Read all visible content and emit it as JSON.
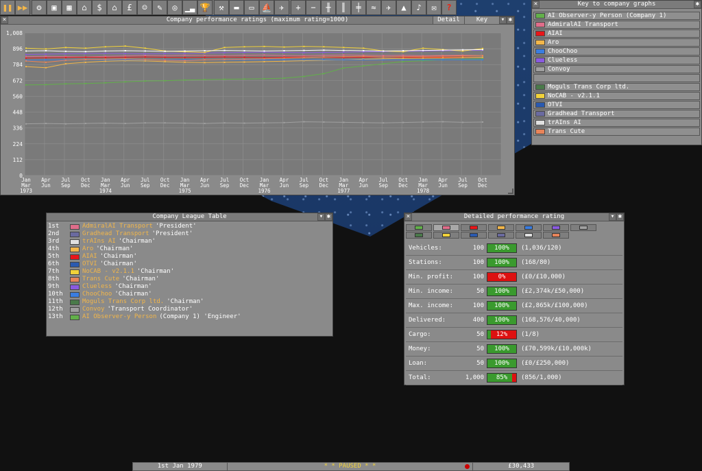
{
  "toolbar": {
    "icons": [
      "pause-icon",
      "fast-forward-icon",
      "settings-icon",
      "save-icon",
      "map-icon",
      "town-directory-icon",
      "subsidies-icon",
      "stations-icon",
      "finances-icon",
      "company-icon",
      "story-icon",
      "goals-icon",
      "graphs-icon",
      "league-icon",
      "industries-icon",
      "trains-icon",
      "road-vehicles-icon",
      "ships-icon",
      "aircraft-icon",
      "zoom-in-icon",
      "zoom-out-icon",
      "build-rail-icon",
      "build-road-icon",
      "build-tramway-icon",
      "build-water-icon",
      "build-air-icon",
      "landscaping-icon",
      "music-icon",
      "messages-icon",
      "help-icon"
    ]
  },
  "graph_window": {
    "title": "Company performance ratings (maximum rating=1000)",
    "detail_button": "Detail",
    "key_button": "Key"
  },
  "chart_data": {
    "type": "line",
    "title": "Company performance ratings (maximum rating=1000)",
    "ylim": [
      0,
      1008
    ],
    "yticks": [
      "0",
      "112",
      "224",
      "336",
      "448",
      "560",
      "672",
      "784",
      "896",
      "1,008"
    ],
    "x_months": [
      "Jan",
      "Apr",
      "Jul",
      "Oct",
      "Jan",
      "Apr",
      "Jul",
      "Oct",
      "Jan",
      "Apr",
      "Jul",
      "Oct",
      "Jan",
      "Apr",
      "Jul",
      "Oct",
      "Jan",
      "Apr",
      "Jul",
      "Oct",
      "Jan",
      "Apr",
      "Jul",
      "Oct"
    ],
    "x_sub": [
      "Mar",
      "Jun",
      "Sep",
      "Dec",
      "Mar",
      "Jun",
      "Sep",
      "Dec",
      "Mar",
      "Jun",
      "Sep",
      "Dec",
      "Mar",
      "Jun",
      "Sep",
      "Dec",
      "Mar",
      "Jun",
      "Sep",
      "Dec",
      "Mar",
      "Jun",
      "Sep",
      "Dec"
    ],
    "x_years": {
      "0": "1973",
      "4": "1974",
      "8": "1975",
      "12": "1976",
      "16": "1977",
      "20": "1978"
    },
    "series": [
      {
        "color": "#62b04a",
        "values": [
          640,
          642,
          648,
          650,
          655,
          662,
          668,
          670,
          675,
          678,
          680,
          682,
          684,
          688,
          700,
          720,
          760,
          775,
          790,
          805,
          812,
          818,
          822,
          825
        ]
      },
      {
        "color": "#e06d8a",
        "values": [
          840,
          842,
          840,
          838,
          842,
          845,
          848,
          846,
          850,
          848,
          846,
          850,
          852,
          848,
          846,
          850,
          852,
          850,
          848,
          850,
          846,
          848,
          850,
          848
        ]
      },
      {
        "color": "#e8161a",
        "values": [
          830,
          832,
          834,
          836,
          834,
          836,
          838,
          836,
          834,
          836,
          838,
          836,
          834,
          836,
          838,
          836,
          834,
          836,
          838,
          836,
          834,
          836,
          838,
          836
        ]
      },
      {
        "color": "#f2b64a",
        "values": [
          770,
          762,
          790,
          800,
          808,
          812,
          810,
          805,
          800,
          798,
          800,
          802,
          805,
          808,
          812,
          815,
          818,
          822,
          825,
          828,
          830,
          832,
          835,
          836
        ]
      },
      {
        "color": "#3a7de0",
        "values": [
          815,
          818,
          818,
          820,
          818,
          818,
          818,
          818,
          818,
          818,
          818,
          818,
          818,
          818,
          818,
          818,
          818,
          818,
          818,
          818,
          818,
          818,
          818,
          818
        ]
      },
      {
        "color": "#8a5ae0",
        "values": [
          855,
          858,
          860,
          862,
          864,
          862,
          860,
          862,
          864,
          866,
          868,
          870,
          872,
          870,
          868,
          870,
          872,
          874,
          876,
          878,
          880,
          882,
          884,
          886
        ]
      },
      {
        "color": "#a0a0a0",
        "values": [
          365,
          368,
          365,
          368,
          370,
          368,
          372,
          372,
          370,
          368,
          372,
          370,
          372,
          374,
          380,
          378,
          376,
          374,
          372,
          375,
          378,
          380,
          376,
          378
        ]
      },
      {
        "color": "#f2d23a",
        "values": [
          900,
          895,
          905,
          900,
          910,
          915,
          900,
          880,
          875,
          870,
          905,
          910,
          912,
          908,
          912,
          910,
          905,
          900,
          880,
          875,
          900,
          890,
          880,
          898
        ]
      },
      {
        "color": "#ffffff",
        "values": [
          880,
          882,
          878,
          876,
          880,
          882,
          880,
          878,
          880,
          882,
          884,
          882,
          880,
          882,
          884,
          886,
          884,
          882,
          880,
          882,
          884,
          886,
          888,
          890
        ]
      },
      {
        "color": "#e8845a",
        "values": [
          810,
          800,
          815,
          820,
          822,
          825,
          820,
          815,
          812,
          818,
          820,
          822,
          825,
          830,
          835,
          838,
          840,
          842,
          838,
          840,
          842,
          844,
          846,
          848
        ]
      }
    ]
  },
  "key_window": {
    "title": "Key to company graphs",
    "entries": [
      {
        "name": "AI Observer-y Person (Company 1)",
        "color": "#62b04a"
      },
      {
        "name": "AdmiralAI Transport",
        "color": "#e06d8a"
      },
      {
        "name": "AIAI",
        "color": "#e8161a"
      },
      {
        "name": "Aro",
        "color": "#f2b64a"
      },
      {
        "name": "ChooChoo",
        "color": "#3a7de0"
      },
      {
        "name": "Clueless",
        "color": "#8a5ae0"
      },
      {
        "name": "Convoy",
        "color": "#a0a0a0"
      },
      {
        "name": "",
        "color": "#8a8a8a"
      },
      {
        "name": "Moguls Trans Corp ltd.",
        "color": "#4a7a4a"
      },
      {
        "name": "NoCAB - v2.1.1",
        "color": "#f2d23a"
      },
      {
        "name": "OTVI",
        "color": "#2a5ab0"
      },
      {
        "name": "Gradhead Transport",
        "color": "#6a6aa0"
      },
      {
        "name": "trAIns AI",
        "color": "#e0e0e0"
      },
      {
        "name": "Trans Cute",
        "color": "#e8845a"
      }
    ]
  },
  "league_window": {
    "title": "Company League Table",
    "rows": [
      {
        "pos": "1st",
        "name": "AdmiralAI Transport",
        "title": "'President'",
        "color": "#e06d8a"
      },
      {
        "pos": "2nd",
        "name": "Gradhead Transport",
        "title": "'President'",
        "color": "#6a6aa0"
      },
      {
        "pos": "3rd",
        "name": "trAIns AI",
        "title": "'Chairman'",
        "color": "#e0e0e0"
      },
      {
        "pos": "4th",
        "name": "Aro",
        "title": "'Chairman'",
        "color": "#f2b64a"
      },
      {
        "pos": "5th",
        "name": "AIAI",
        "title": "'Chairman'",
        "color": "#e8161a"
      },
      {
        "pos": "6th",
        "name": "OTVI",
        "title": "'Chairman'",
        "color": "#2a5ab0"
      },
      {
        "pos": "7th",
        "name": "NoCAB - v2.1.1",
        "title": "'Chairman'",
        "color": "#f2d23a"
      },
      {
        "pos": "8th",
        "name": "Trans Cute",
        "title": "'Chairman'",
        "color": "#e8845a"
      },
      {
        "pos": "9th",
        "name": "Clueless",
        "title": "'Chairman'",
        "color": "#8a5ae0"
      },
      {
        "pos": "10th",
        "name": "ChooChoo",
        "title": "'Chairman'",
        "color": "#3a7de0"
      },
      {
        "pos": "11th",
        "name": "Moguls Trans Corp ltd.",
        "title": "'Chairman'",
        "color": "#4a7a4a"
      },
      {
        "pos": "12th",
        "name": "Convoy",
        "title": "'Transport Coordinator'",
        "color": "#a0a0a0"
      },
      {
        "pos": "13th",
        "name": "AI Observer-y Person",
        "title": "(Company 1) 'Engineer'",
        "color": "#62b04a"
      }
    ]
  },
  "perf_window": {
    "title": "Detailed performance rating",
    "tabs_row1": [
      "#62b04a",
      "#e06d8a",
      "#e8161a",
      "#f2b64a",
      "#3a7de0",
      "#8a5ae0",
      "#a0a0a0"
    ],
    "tabs_row2": [
      "#4a7a4a",
      "#f2d23a",
      "#2a5ab0",
      "#6a6aa0",
      "#e0e0e0",
      "#e8845a"
    ],
    "rows": [
      {
        "label": "Vehicles:",
        "max": "100",
        "pct_text": "100%",
        "pct": 1.0,
        "detail": "(1,036/120)"
      },
      {
        "label": "Stations:",
        "max": "100",
        "pct_text": "100%",
        "pct": 1.0,
        "detail": "(168/80)"
      },
      {
        "label": "Min. profit:",
        "max": "100",
        "pct_text": "0%",
        "pct": 0.0,
        "detail": "(£0/£10,000)"
      },
      {
        "label": "Min. income:",
        "max": "50",
        "pct_text": "100%",
        "pct": 1.0,
        "detail": "(£2,374k/£50,000)"
      },
      {
        "label": "Max. income:",
        "max": "100",
        "pct_text": "100%",
        "pct": 1.0,
        "detail": "(£2,865k/£100,000)"
      },
      {
        "label": "Delivered:",
        "max": "400",
        "pct_text": "100%",
        "pct": 1.0,
        "detail": "(168,576/40,000)"
      },
      {
        "label": "Cargo:",
        "max": "50",
        "pct_text": "12%",
        "pct": 0.12,
        "detail": "(1/8)"
      },
      {
        "label": "Money:",
        "max": "50",
        "pct_text": "100%",
        "pct": 1.0,
        "detail": "(£70,599k/£10,000k)"
      },
      {
        "label": "Loan:",
        "max": "50",
        "pct_text": "100%",
        "pct": 1.0,
        "detail": "(£0/£250,000)"
      },
      {
        "label": "Total:",
        "max": "1,000",
        "pct_text": "85%",
        "pct": 0.85,
        "detail": "(856/1,000)"
      }
    ]
  },
  "statusbar": {
    "date": "1st Jan 1979",
    "paused": "*  *  PAUSED  *  *",
    "money": "£30,433"
  }
}
